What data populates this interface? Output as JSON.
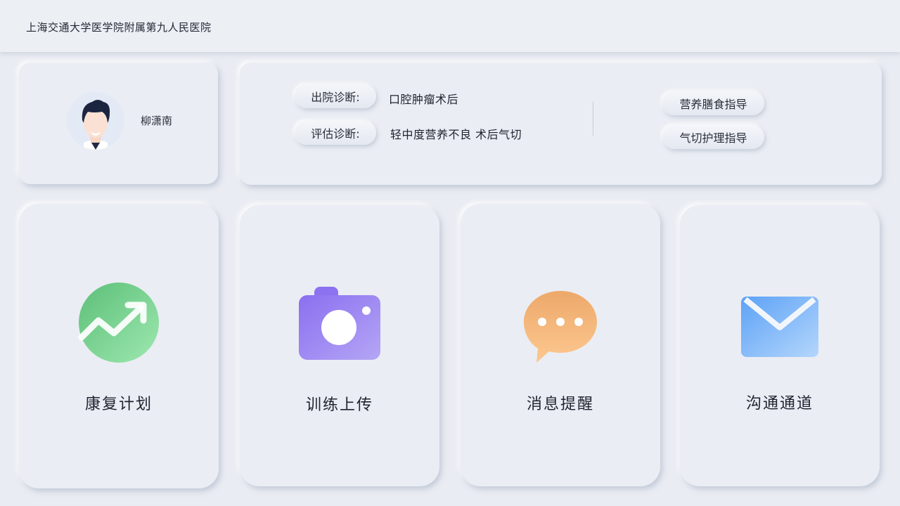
{
  "header": {
    "title": "上海交通大学医学院附属第九人民医院"
  },
  "patient": {
    "name": "柳潇南",
    "avatar_icon": "person-avatar-icon"
  },
  "diagnosis": {
    "discharge_label": "出院诊断:",
    "discharge_value": "口腔肿瘤术后",
    "assessment_label": "评估诊断:",
    "assessment_value": "轻中度营养不良 术后气切"
  },
  "guides": [
    {
      "label": "营养膳食指导"
    },
    {
      "label": "气切护理指导"
    }
  ],
  "tiles": [
    {
      "label": "康复计划",
      "icon": "trend-up-icon",
      "color": "#6dcc8a"
    },
    {
      "label": "训练上传",
      "icon": "camera-icon",
      "color": "#9b84f2"
    },
    {
      "label": "消息提醒",
      "icon": "chat-bubble-icon",
      "color": "#f2b06e"
    },
    {
      "label": "沟通通道",
      "icon": "mail-icon",
      "color": "#6aaef7"
    }
  ]
}
